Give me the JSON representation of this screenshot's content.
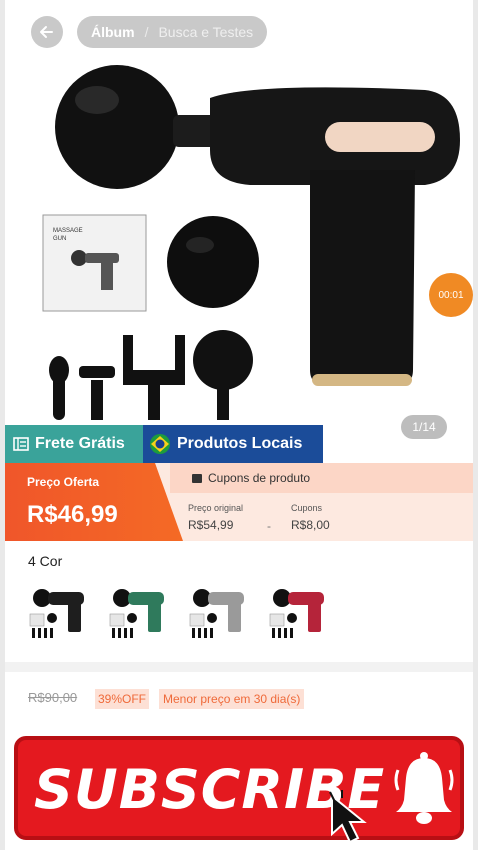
{
  "header": {
    "breadcrumb_primary": "Álbum",
    "breadcrumb_separator": "/",
    "breadcrumb_secondary": "Busca e Testes"
  },
  "gallery": {
    "timer": "00:01",
    "page_counter": "1/14",
    "box_text": "MASSAGE GUN"
  },
  "tags": {
    "free_shipping": "Frete Grátis",
    "local_products": "Produtos Locais"
  },
  "price": {
    "offer_label": "Preço Oferta",
    "offer_value": "R$46,99",
    "coupons_title": "Cupons de produto",
    "original_label": "Preço original",
    "original_value": "R$54,99",
    "dash": "-",
    "coupon_label": "Cupons",
    "coupon_value": "R$8,00"
  },
  "colors": {
    "title": "4 Cor",
    "swatches": [
      {
        "name": "black",
        "color": "#1e1e1e"
      },
      {
        "name": "green",
        "color": "#2f7a5c"
      },
      {
        "name": "gray",
        "color": "#9a9a9a"
      },
      {
        "name": "red",
        "color": "#b5243a"
      }
    ]
  },
  "strip": {
    "strike_price": "R$90,00",
    "discount": "39%OFF",
    "lowest": "Menor preço em 30 dia(s)"
  },
  "subscribe": {
    "label": "SUBSCRIBE",
    "brand_color": "#e4191f"
  }
}
